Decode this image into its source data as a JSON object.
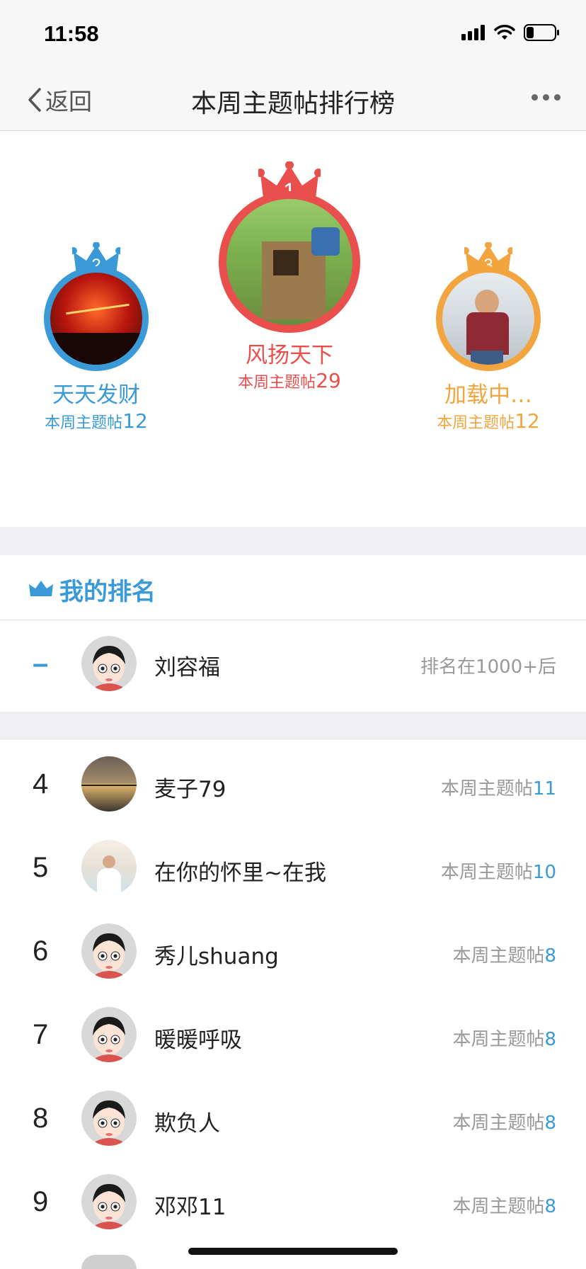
{
  "status": {
    "time": "11:58"
  },
  "nav": {
    "back_label": "返回",
    "title": "本周主题帖排行榜"
  },
  "podium": [
    {
      "rank": "2",
      "name": "天天发财",
      "count_label": "本周主题帖",
      "count": "12",
      "color": "#3a9ad8"
    },
    {
      "rank": "1",
      "name": "风扬天下",
      "count_label": "本周主题帖",
      "count": "29",
      "color": "#e9504d"
    },
    {
      "rank": "3",
      "name": "加载中…",
      "count_label": "本周主题帖",
      "count": "12",
      "color": "#f2a43f"
    }
  ],
  "my_rank": {
    "section_title": "我的排名",
    "rank": "–",
    "name": "刘容福",
    "status": "排名在1000+后"
  },
  "list": [
    {
      "rank": "4",
      "name": "麦子79",
      "count_label": "本周主题帖",
      "count": "11"
    },
    {
      "rank": "5",
      "name": "在你的怀里~在我",
      "count_label": "本周主题帖",
      "count": "10"
    },
    {
      "rank": "6",
      "name": "秀儿shuang",
      "count_label": "本周主题帖",
      "count": "8"
    },
    {
      "rank": "7",
      "name": "暖暖呼吸",
      "count_label": "本周主题帖",
      "count": "8"
    },
    {
      "rank": "8",
      "name": "欺负人",
      "count_label": "本周主题帖",
      "count": "8"
    },
    {
      "rank": "9",
      "name": "邓邓11",
      "count_label": "本周主题帖",
      "count": "8"
    }
  ],
  "colors": {
    "accent": "#3a9ad8",
    "first": "#e9504d",
    "second": "#3a9ad8",
    "third": "#f2a43f"
  }
}
